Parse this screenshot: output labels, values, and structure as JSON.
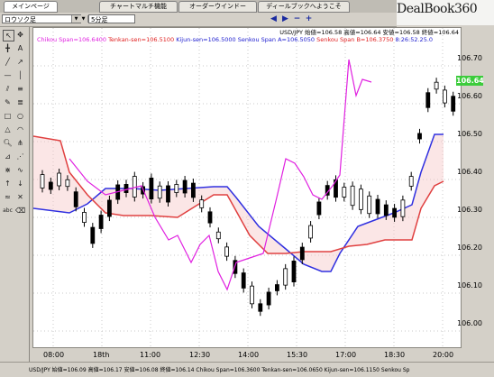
{
  "tabs": [
    {
      "label": "メインページ",
      "active": true
    },
    {
      "label": "チャートマルチ機能",
      "active": false
    },
    {
      "label": "オーダーウインドー",
      "active": false
    },
    {
      "label": "ディールブックへようこそ",
      "active": false
    }
  ],
  "logo": "DealBook360",
  "toolbar": {
    "chart_type_value": "ロウソク足",
    "timeframe_value": "5分足"
  },
  "info": {
    "ohlc": "USD/JPY 始値=106.58 高値=106.64 安値=106.58 終値=106.64",
    "chikou": "Chikou Span=106.6400",
    "tenkan": "Tenkan-sen=106.5100",
    "kijun": "Kijun-sen=106.5000",
    "senkou_a": "Senkou Span A=106.5050",
    "senkou_b": "Senkou Span B=106.3750",
    "timestamp": "8:26:52.25.0"
  },
  "y_labels": [
    "106.70",
    "106.60",
    "106.50",
    "106.40",
    "106.30",
    "106.20",
    "106.10",
    "106.00"
  ],
  "x_labels": [
    "08:00",
    "18th",
    "11:00",
    "12:30",
    "14:00",
    "15:30",
    "17:00",
    "18:30",
    "20:00"
  ],
  "current_price": "106.64",
  "status_bar": "USD/JPY 始値=106.09 高値=106.17 安値=106.08 終値=106.14   Chikou Span=106.3600 Tenkan-sen=106.0650 Kijun-sen=106.1150 Senkou Sp",
  "colors": {
    "chikou": "#e020e0",
    "tenkan": "#e02020",
    "kijun": "#2020d0",
    "cloud_red": "#e04040",
    "cloud_blue": "#3030e0",
    "price_badge": "#3ccc3c"
  }
}
